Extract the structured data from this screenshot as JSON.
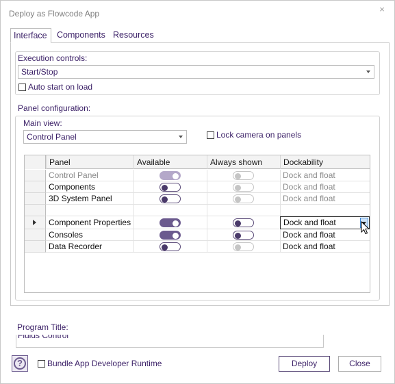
{
  "window": {
    "title": "Deploy as Flowcode App",
    "close_glyph": "×"
  },
  "tabs": [
    {
      "label": "Interface",
      "active": true
    },
    {
      "label": "Components",
      "active": false
    },
    {
      "label": "Resources",
      "active": false
    }
  ],
  "execution": {
    "label": "Execution controls:",
    "value": "Start/Stop",
    "auto_start_label": "Auto start on load",
    "auto_start_checked": false
  },
  "panel_config": {
    "label": "Panel configuration:",
    "main_view_label": "Main view:",
    "main_view_value": "Control Panel",
    "lock_camera_label": "Lock camera on panels",
    "lock_camera_checked": false
  },
  "grid": {
    "columns": [
      "Panel",
      "Available",
      "Always shown",
      "Dockability"
    ],
    "rows": [
      {
        "panel": "Control Panel",
        "available": "on-disabled",
        "always_shown": "off-disabled",
        "dock": "Dock and float",
        "enabled": false
      },
      {
        "panel": "Components",
        "available": "off",
        "always_shown": "off-disabled",
        "dock": "Dock and float",
        "enabled": true
      },
      {
        "panel": "3D System Panel",
        "available": "off",
        "always_shown": "off-disabled",
        "dock": "Dock and float",
        "enabled": true
      },
      {
        "panel": "",
        "available": "",
        "always_shown": "",
        "dock": "",
        "enabled": true
      },
      {
        "panel": "Component Properties",
        "available": "on",
        "always_shown": "off",
        "dock": "Dock and float",
        "enabled": true,
        "selected": true
      },
      {
        "panel": "Consoles",
        "available": "on",
        "always_shown": "off",
        "dock": "Dock and float",
        "enabled": true
      },
      {
        "panel": "Data Recorder",
        "available": "off",
        "always_shown": "off-disabled",
        "dock": "Dock and float",
        "enabled": true
      }
    ]
  },
  "program_title": {
    "label": "Program Title:",
    "value": "Fluids Control"
  },
  "footer": {
    "help_glyph": "?",
    "bundle_label": "Bundle App Developer Runtime",
    "bundle_checked": false,
    "deploy_label": "Deploy",
    "close_label": "Close"
  },
  "colors": {
    "accent": "#6b5a8e",
    "text_link": "#3a1f66",
    "selection_blue": "#3b86d6"
  }
}
